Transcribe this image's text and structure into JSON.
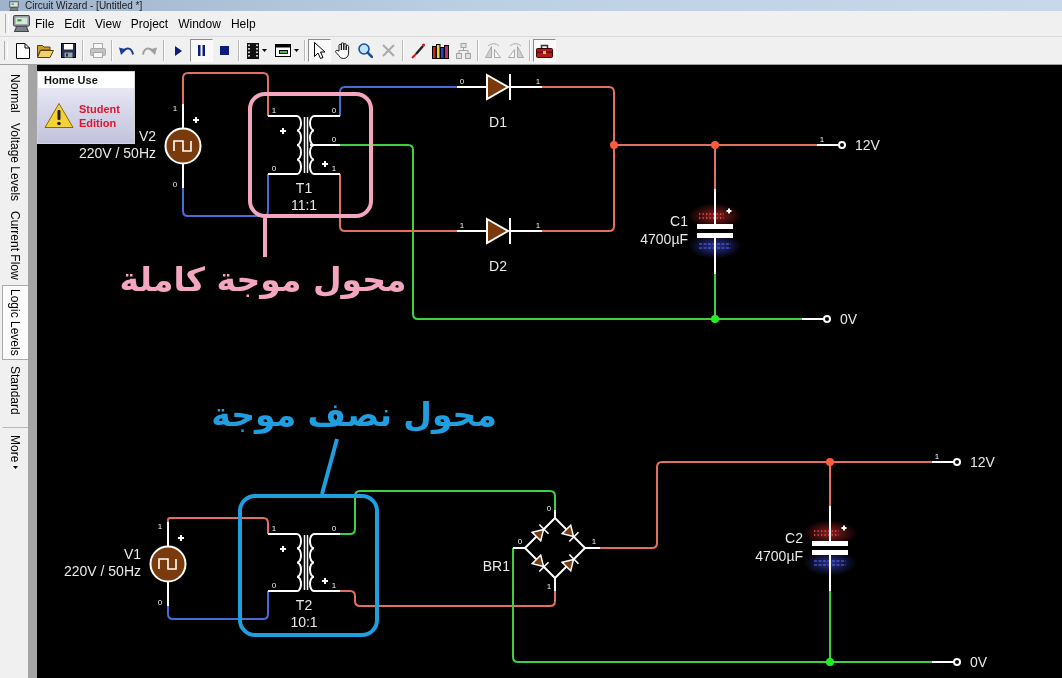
{
  "window": {
    "title": "Circuit Wizard - [Untitled *]"
  },
  "menu": [
    "File",
    "Edit",
    "View",
    "Project",
    "Window",
    "Help"
  ],
  "toolbar": [
    [
      {
        "kind": "new",
        "disabled": false,
        "pressed": false
      },
      {
        "kind": "open",
        "disabled": false,
        "pressed": false
      },
      {
        "kind": "save",
        "disabled": false,
        "pressed": false
      }
    ],
    [
      {
        "kind": "print",
        "disabled": true,
        "pressed": false
      }
    ],
    [
      {
        "kind": "undo",
        "disabled": false,
        "pressed": false
      },
      {
        "kind": "redo",
        "disabled": true,
        "pressed": false
      }
    ],
    [
      {
        "kind": "run",
        "disabled": false,
        "pressed": false
      },
      {
        "kind": "pause",
        "disabled": false,
        "pressed": true
      },
      {
        "kind": "stop",
        "disabled": false,
        "pressed": false
      }
    ],
    [
      {
        "kind": "chip",
        "disabled": false,
        "pressed": false
      },
      {
        "kind": "panel",
        "disabled": false,
        "pressed": false
      }
    ],
    [
      {
        "kind": "pointer",
        "disabled": false,
        "pressed": true
      },
      {
        "kind": "hand",
        "disabled": false,
        "pressed": false
      },
      {
        "kind": "zoom",
        "disabled": false,
        "pressed": false
      },
      {
        "kind": "delete",
        "disabled": true,
        "pressed": false
      }
    ],
    [
      {
        "kind": "probe",
        "disabled": false,
        "pressed": false
      },
      {
        "kind": "books",
        "disabled": false,
        "pressed": false
      },
      {
        "kind": "tree",
        "disabled": true,
        "pressed": false
      }
    ],
    [
      {
        "kind": "flip",
        "disabled": true,
        "pressed": false
      },
      {
        "kind": "mirror",
        "disabled": true,
        "pressed": false
      }
    ],
    [
      {
        "kind": "toolbox",
        "disabled": false,
        "pressed": true
      }
    ]
  ],
  "view_tabs": [
    {
      "label": "Normal",
      "selected": false
    },
    {
      "label": "Voltage Levels",
      "selected": false
    },
    {
      "label": "Current Flow",
      "selected": false
    },
    {
      "label": "Logic Levels",
      "selected": true
    },
    {
      "label": "Standard",
      "selected": false
    }
  ],
  "more_button": {
    "label": "More"
  },
  "edition_badge": {
    "heading": "Home Use",
    "text": "Student Edition"
  },
  "circuits": [
    {
      "components": [
        {
          "kind": "source",
          "name": "V2",
          "value": "220V / 50Hz",
          "pins": [
            "1",
            "0"
          ]
        },
        {
          "kind": "transformer",
          "name": "T1",
          "value": "11:1",
          "center_tap": true,
          "pins": [
            "1",
            "0",
            "0",
            "0",
            "1"
          ]
        },
        {
          "kind": "diode",
          "name": "D1",
          "pins": [
            "0",
            "1"
          ]
        },
        {
          "kind": "diode",
          "name": "D2",
          "pins": [
            "1",
            "1"
          ]
        },
        {
          "kind": "capacitor",
          "name": "C1",
          "value": "4700µF",
          "charged": true
        },
        {
          "kind": "terminal",
          "label": "12V",
          "pins": [
            "1"
          ]
        },
        {
          "kind": "terminal",
          "label": "0V"
        }
      ],
      "wires": [
        {
          "color": "#e2705c"
        },
        {
          "color": "#4a6ad8"
        },
        {
          "color": "#4a6ad8"
        },
        {
          "color": "#3fd23f"
        },
        {
          "color": "#e2705c"
        },
        {
          "color": "#e2705c"
        },
        {
          "color": "#e2705c"
        },
        {
          "color": "#e2705c"
        },
        {
          "color": "#3fd23f"
        }
      ],
      "junctions": [
        {
          "color": "#ff5a3c"
        },
        {
          "color": "#ff5a3c"
        },
        {
          "color": "#22ee22"
        }
      ]
    },
    {
      "components": [
        {
          "kind": "source",
          "name": "V1",
          "value": "220V / 50Hz",
          "pins": [
            "1",
            "0"
          ]
        },
        {
          "kind": "transformer",
          "name": "T2",
          "value": "10:1",
          "center_tap": false,
          "pins": [
            "1",
            "0",
            "0",
            "1"
          ]
        },
        {
          "kind": "bridge",
          "name": "BR1",
          "pins": [
            "0",
            "0",
            "1",
            "1"
          ]
        },
        {
          "kind": "capacitor",
          "name": "C2",
          "value": "4700µF",
          "charged": true
        },
        {
          "kind": "terminal",
          "label": "12V",
          "pins": [
            "1"
          ]
        },
        {
          "kind": "terminal",
          "label": "0V"
        }
      ],
      "wires": [
        {
          "color": "#e2705c"
        },
        {
          "color": "#4a6ad8"
        },
        {
          "color": "#3fd23f"
        },
        {
          "color": "#e2705c"
        },
        {
          "color": "#3fd23f"
        },
        {
          "color": "#e2705c"
        },
        {
          "color": "#e2705c"
        },
        {
          "color": "#3fd23f"
        }
      ],
      "junctions": [
        {
          "color": "#ff5a3c"
        },
        {
          "color": "#22ee22"
        }
      ]
    }
  ],
  "annotations": [
    {
      "text": "محول موجة كاملة",
      "color": "#f4a6bf"
    },
    {
      "text": "محول نصف موجة",
      "color": "#1f9fe0"
    }
  ]
}
